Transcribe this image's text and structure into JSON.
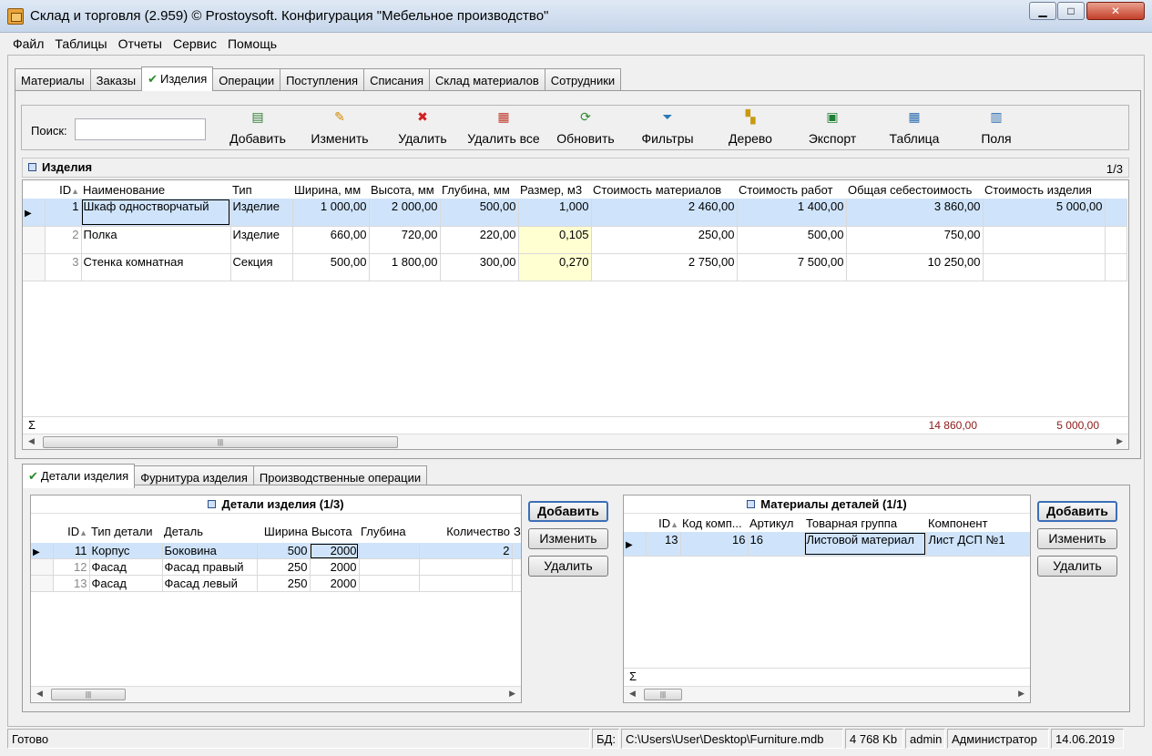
{
  "window": {
    "title": "Склад и торговля (2.959) © Prostoysoft. Конфигурация \"Мебельное производство\"",
    "min_label": "▁",
    "max_label": "□",
    "close_label": "✕"
  },
  "menu": [
    "Файл",
    "Таблицы",
    "Отчеты",
    "Сервис",
    "Помощь"
  ],
  "tabs": [
    {
      "label": "Материалы",
      "active": false
    },
    {
      "label": "Заказы",
      "active": false
    },
    {
      "label": "Изделия",
      "active": true
    },
    {
      "label": "Операции",
      "active": false
    },
    {
      "label": "Поступления",
      "active": false
    },
    {
      "label": "Списания",
      "active": false
    },
    {
      "label": "Склад материалов",
      "active": false
    },
    {
      "label": "Сотрудники",
      "active": false
    }
  ],
  "toolbar": {
    "search_label": "Поиск:",
    "search_value": "",
    "buttons": [
      {
        "label": "Добавить",
        "icon": "add-document-icon",
        "glyph": "▤",
        "color": "#2e7d32"
      },
      {
        "label": "Изменить",
        "icon": "pencil-icon",
        "glyph": "✎",
        "color": "#d08a00"
      },
      {
        "label": "Удалить",
        "icon": "delete-x-icon",
        "glyph": "✖",
        "color": "#d32020"
      },
      {
        "label": "Удалить все",
        "icon": "delete-all-icon",
        "glyph": "▦",
        "color": "#c0392b"
      },
      {
        "label": "Обновить",
        "icon": "refresh-icon",
        "glyph": "⟳",
        "color": "#2e8b2e"
      },
      {
        "label": "Фильтры",
        "icon": "filter-icon",
        "glyph": "⏷",
        "color": "#2a7ab8"
      },
      {
        "label": "Дерево",
        "icon": "tree-icon",
        "glyph": "▚",
        "color": "#c99a10"
      },
      {
        "label": "Экспорт",
        "icon": "export-excel-icon",
        "glyph": "▣",
        "color": "#1e7e34"
      },
      {
        "label": "Таблица",
        "icon": "table-icon",
        "glyph": "▦",
        "color": "#2c6cb0"
      },
      {
        "label": "Поля",
        "icon": "fields-icon",
        "glyph": "▥",
        "color": "#2c6cb0"
      }
    ]
  },
  "products": {
    "title": "Изделия",
    "page": "1/3",
    "columns": [
      "ID",
      "Наименование",
      "Тип",
      "Ширина, мм",
      "Высота, мм",
      "Глубина, мм",
      "Размер, м3",
      "Стоимость материалов",
      "Стоимость работ",
      "Общая себестоимость",
      "Стоимость изделия"
    ],
    "rows": [
      [
        "1",
        "Шкаф одностворчатый",
        "Изделие",
        "1 000,00",
        "2 000,00",
        "500,00",
        "1,000",
        "2 460,00",
        "1 400,00",
        "3 860,00",
        "5 000,00"
      ],
      [
        "2",
        "Полка",
        "Изделие",
        "660,00",
        "720,00",
        "220,00",
        "0,105",
        "250,00",
        "500,00",
        "750,00",
        ""
      ],
      [
        "3",
        "Стенка комнатная",
        "Секция",
        "500,00",
        "1 800,00",
        "300,00",
        "0,270",
        "2 750,00",
        "7 500,00",
        "10 250,00",
        ""
      ]
    ],
    "sum_symbol": "Σ",
    "sum_total_cost": "14 860,00",
    "sum_product_cost": "5 000,00",
    "row_indicator": "▶"
  },
  "bottom_tabs": [
    {
      "label": "Детали изделия",
      "active": true
    },
    {
      "label": "Фурнитура изделия",
      "active": false
    },
    {
      "label": "Производственные операции",
      "active": false
    }
  ],
  "details": {
    "title": "Детали изделия (1/3)",
    "columns": [
      "ID",
      "Тип детали",
      "Деталь",
      "Ширина",
      "Высота",
      "Глубина",
      "Количество",
      "З"
    ],
    "rows": [
      [
        "11",
        "Корпус",
        "Боковина",
        "500",
        "2000",
        "",
        "2",
        ""
      ],
      [
        "12",
        "Фасад",
        "Фасад правый",
        "250",
        "2000",
        "",
        "",
        ""
      ],
      [
        "13",
        "Фасад",
        "Фасад левый",
        "250",
        "2000",
        "",
        "",
        ""
      ]
    ]
  },
  "details_buttons": {
    "add": "Добавить",
    "edit": "Изменить",
    "delete": "Удалить"
  },
  "materials": {
    "title": "Материалы деталей (1/1)",
    "columns": [
      "ID",
      "Код комп...",
      "Артикул",
      "Товарная группа",
      "Компонент"
    ],
    "rows": [
      [
        "13",
        "16",
        "16",
        "Листовой материал",
        "Лист ДСП №1"
      ]
    ],
    "sum_symbol": "Σ"
  },
  "materials_buttons": {
    "add": "Добавить",
    "edit": "Изменить",
    "delete": "Удалить"
  },
  "status": {
    "ready": "Готово",
    "db_label": "БД:",
    "db_path": "C:\\Users\\User\\Desktop\\Furniture.mdb",
    "db_size": "4 768 Kb",
    "user": "admin",
    "role": "Администратор",
    "date": "14.06.2019"
  }
}
